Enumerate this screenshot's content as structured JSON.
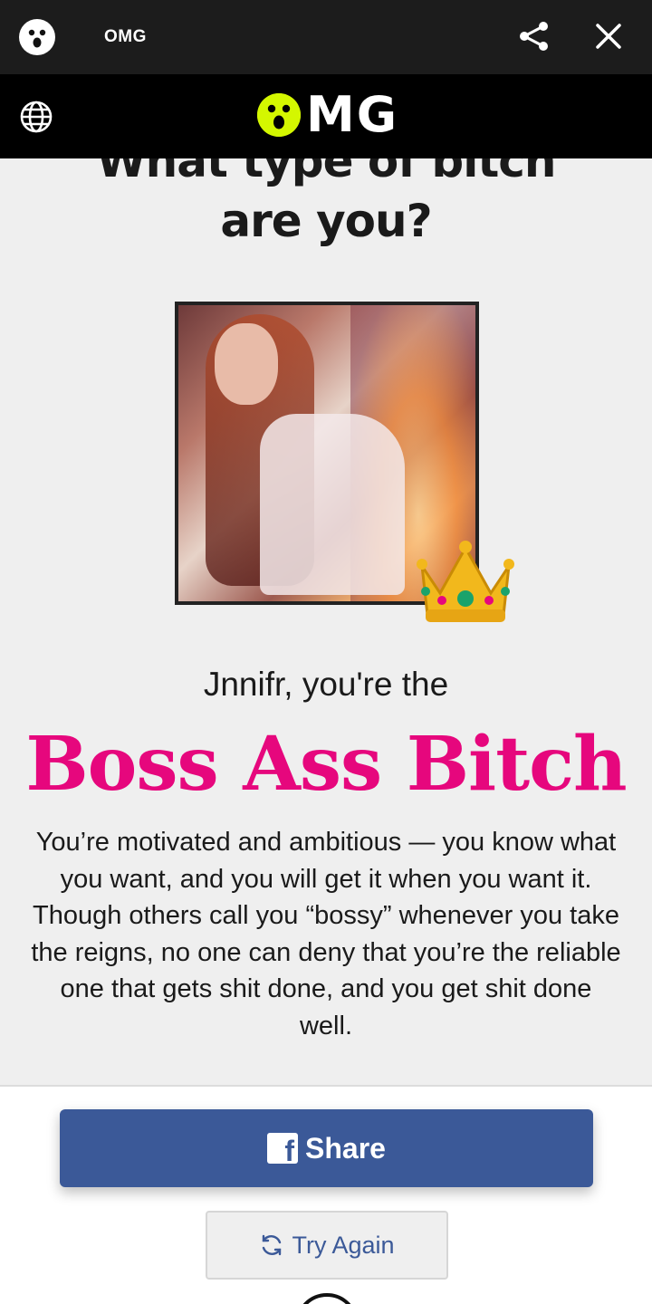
{
  "topbar": {
    "title": "OMG",
    "icons": [
      "app-face-icon",
      "share-icon",
      "close-icon"
    ]
  },
  "brandbar": {
    "logo_text": "MG",
    "icons": [
      "globe-icon",
      "omg-logo-face-icon"
    ],
    "logo_color": "#d4f700"
  },
  "quiz": {
    "title": "What type of bitch are you?"
  },
  "result": {
    "intro": "Jnnifr, you're the",
    "name": "Boss Ass Bitch",
    "name_color": "#e6077d",
    "description": "You’re motivated and ambitious — you know what you want, and you will get it when you want it. Though others call you “bossy” whenever you take the reigns, no one can deny that you’re the reliable one that gets shit done, and you get shit done well."
  },
  "actions": {
    "share_label": "Share",
    "share_icon": "facebook-icon",
    "share_color": "#3b5998",
    "retry_label": "Try Again",
    "retry_icon": "refresh-icon"
  }
}
